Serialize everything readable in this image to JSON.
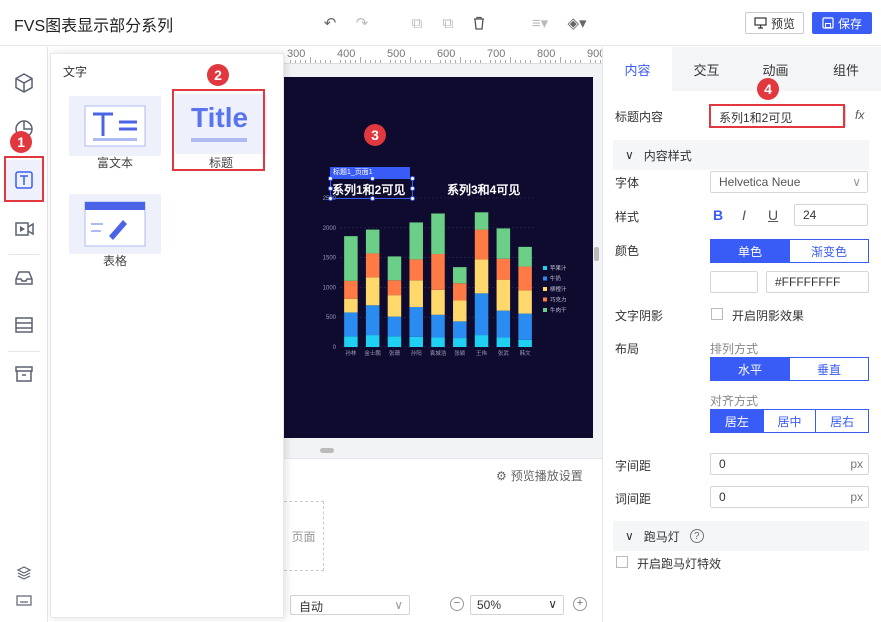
{
  "app": {
    "title": "FVS图表显示部分系列"
  },
  "toolbar": {
    "preview_label": "预览",
    "save_label": "保存"
  },
  "flyout": {
    "title": "文字",
    "items": [
      {
        "label": "富文本",
        "icon": "rich-text-icon"
      },
      {
        "label": "标题",
        "icon": "title-icon",
        "preview_text": "Title"
      },
      {
        "label": "表格",
        "icon": "table-icon"
      }
    ]
  },
  "ruler": {
    "ticks": [
      "300",
      "400",
      "500",
      "600",
      "700",
      "800",
      "900"
    ]
  },
  "canvas": {
    "title_tag": "标题1_页面1",
    "title1": "系列1和2可见",
    "title2": "系列3和4可见",
    "play_settings": "预览播放设置",
    "page_label": "页面",
    "auto_select": "自动",
    "zoom": "50%"
  },
  "chart_data": {
    "type": "bar",
    "stacked": true,
    "categories": [
      "孙林",
      "金士鹏",
      "张珊",
      "孙阳",
      "袁城浩",
      "张颖",
      "王伟",
      "张武",
      "韩文"
    ],
    "yticks": [
      "0",
      "500",
      "1000",
      "1500",
      "2000",
      "2500"
    ],
    "ylim": [
      0,
      2500
    ],
    "legend_position": "right",
    "series": [
      {
        "name": "苹果汁",
        "color": "#1fd0f2",
        "values": [
          180,
          200,
          180,
          170,
          160,
          150,
          200,
          160,
          120
        ]
      },
      {
        "name": "牛奶",
        "color": "#2a8cf0",
        "values": [
          400,
          500,
          330,
          500,
          380,
          280,
          700,
          450,
          440
        ]
      },
      {
        "name": "柳橙汁",
        "color": "#ffd86b",
        "values": [
          230,
          470,
          360,
          450,
          420,
          350,
          570,
          520,
          390
        ]
      },
      {
        "name": "巧克力",
        "color": "#ff7a45",
        "values": [
          300,
          400,
          250,
          350,
          600,
          290,
          500,
          350,
          400
        ]
      },
      {
        "name": "牛肉干",
        "color": "#6ccf88",
        "values": [
          750,
          400,
          400,
          620,
          680,
          270,
          290,
          510,
          330
        ]
      }
    ]
  },
  "panel": {
    "tabs": [
      "内容",
      "交互",
      "动画",
      "组件"
    ],
    "title_content_label": "标题内容",
    "title_content_value": "系列1和2可见",
    "fx": "fx",
    "style_section": "内容样式",
    "font_label": "字体",
    "font_value": "Helvetica Neue",
    "style_label": "样式",
    "bold": "B",
    "italic": "I",
    "underline": "U",
    "font_size": "24",
    "color_label": "颜色",
    "color_modes": [
      "单色",
      "渐变色"
    ],
    "color_value": "#FFFFFFFF",
    "shadow_label": "文字阴影",
    "shadow_option": "开启阴影效果",
    "layout_label": "布局",
    "arrange_label": "排列方式",
    "arrange_options": [
      "水平",
      "垂直"
    ],
    "align_label": "对齐方式",
    "align_options": [
      "居左",
      "居中",
      "居右"
    ],
    "letter_spacing_label": "字间距",
    "letter_spacing_value": "0",
    "word_spacing_label": "词间距",
    "word_spacing_value": "0",
    "unit": "px",
    "marquee_section": "跑马灯",
    "marquee_option": "开启跑马灯特效"
  },
  "annotations": [
    "1",
    "2",
    "3",
    "4"
  ],
  "colors": {
    "accent": "#3a5cf6",
    "annotation": "#e0383e",
    "stage": "#0f0b2f"
  }
}
